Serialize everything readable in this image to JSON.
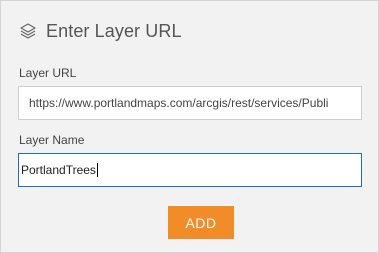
{
  "header": {
    "icon": "layers-icon",
    "title": "Enter Layer URL"
  },
  "form": {
    "url_label": "Layer URL",
    "url_value": "https://www.portlandmaps.com/arcgis/rest/services/Publi",
    "name_label": "Layer Name",
    "name_value": "PortlandTrees"
  },
  "actions": {
    "add_label": "ADD"
  },
  "colors": {
    "accent": "#f28c28",
    "focus_border": "#1e6fb8",
    "panel_bg": "#f2f2f2"
  }
}
